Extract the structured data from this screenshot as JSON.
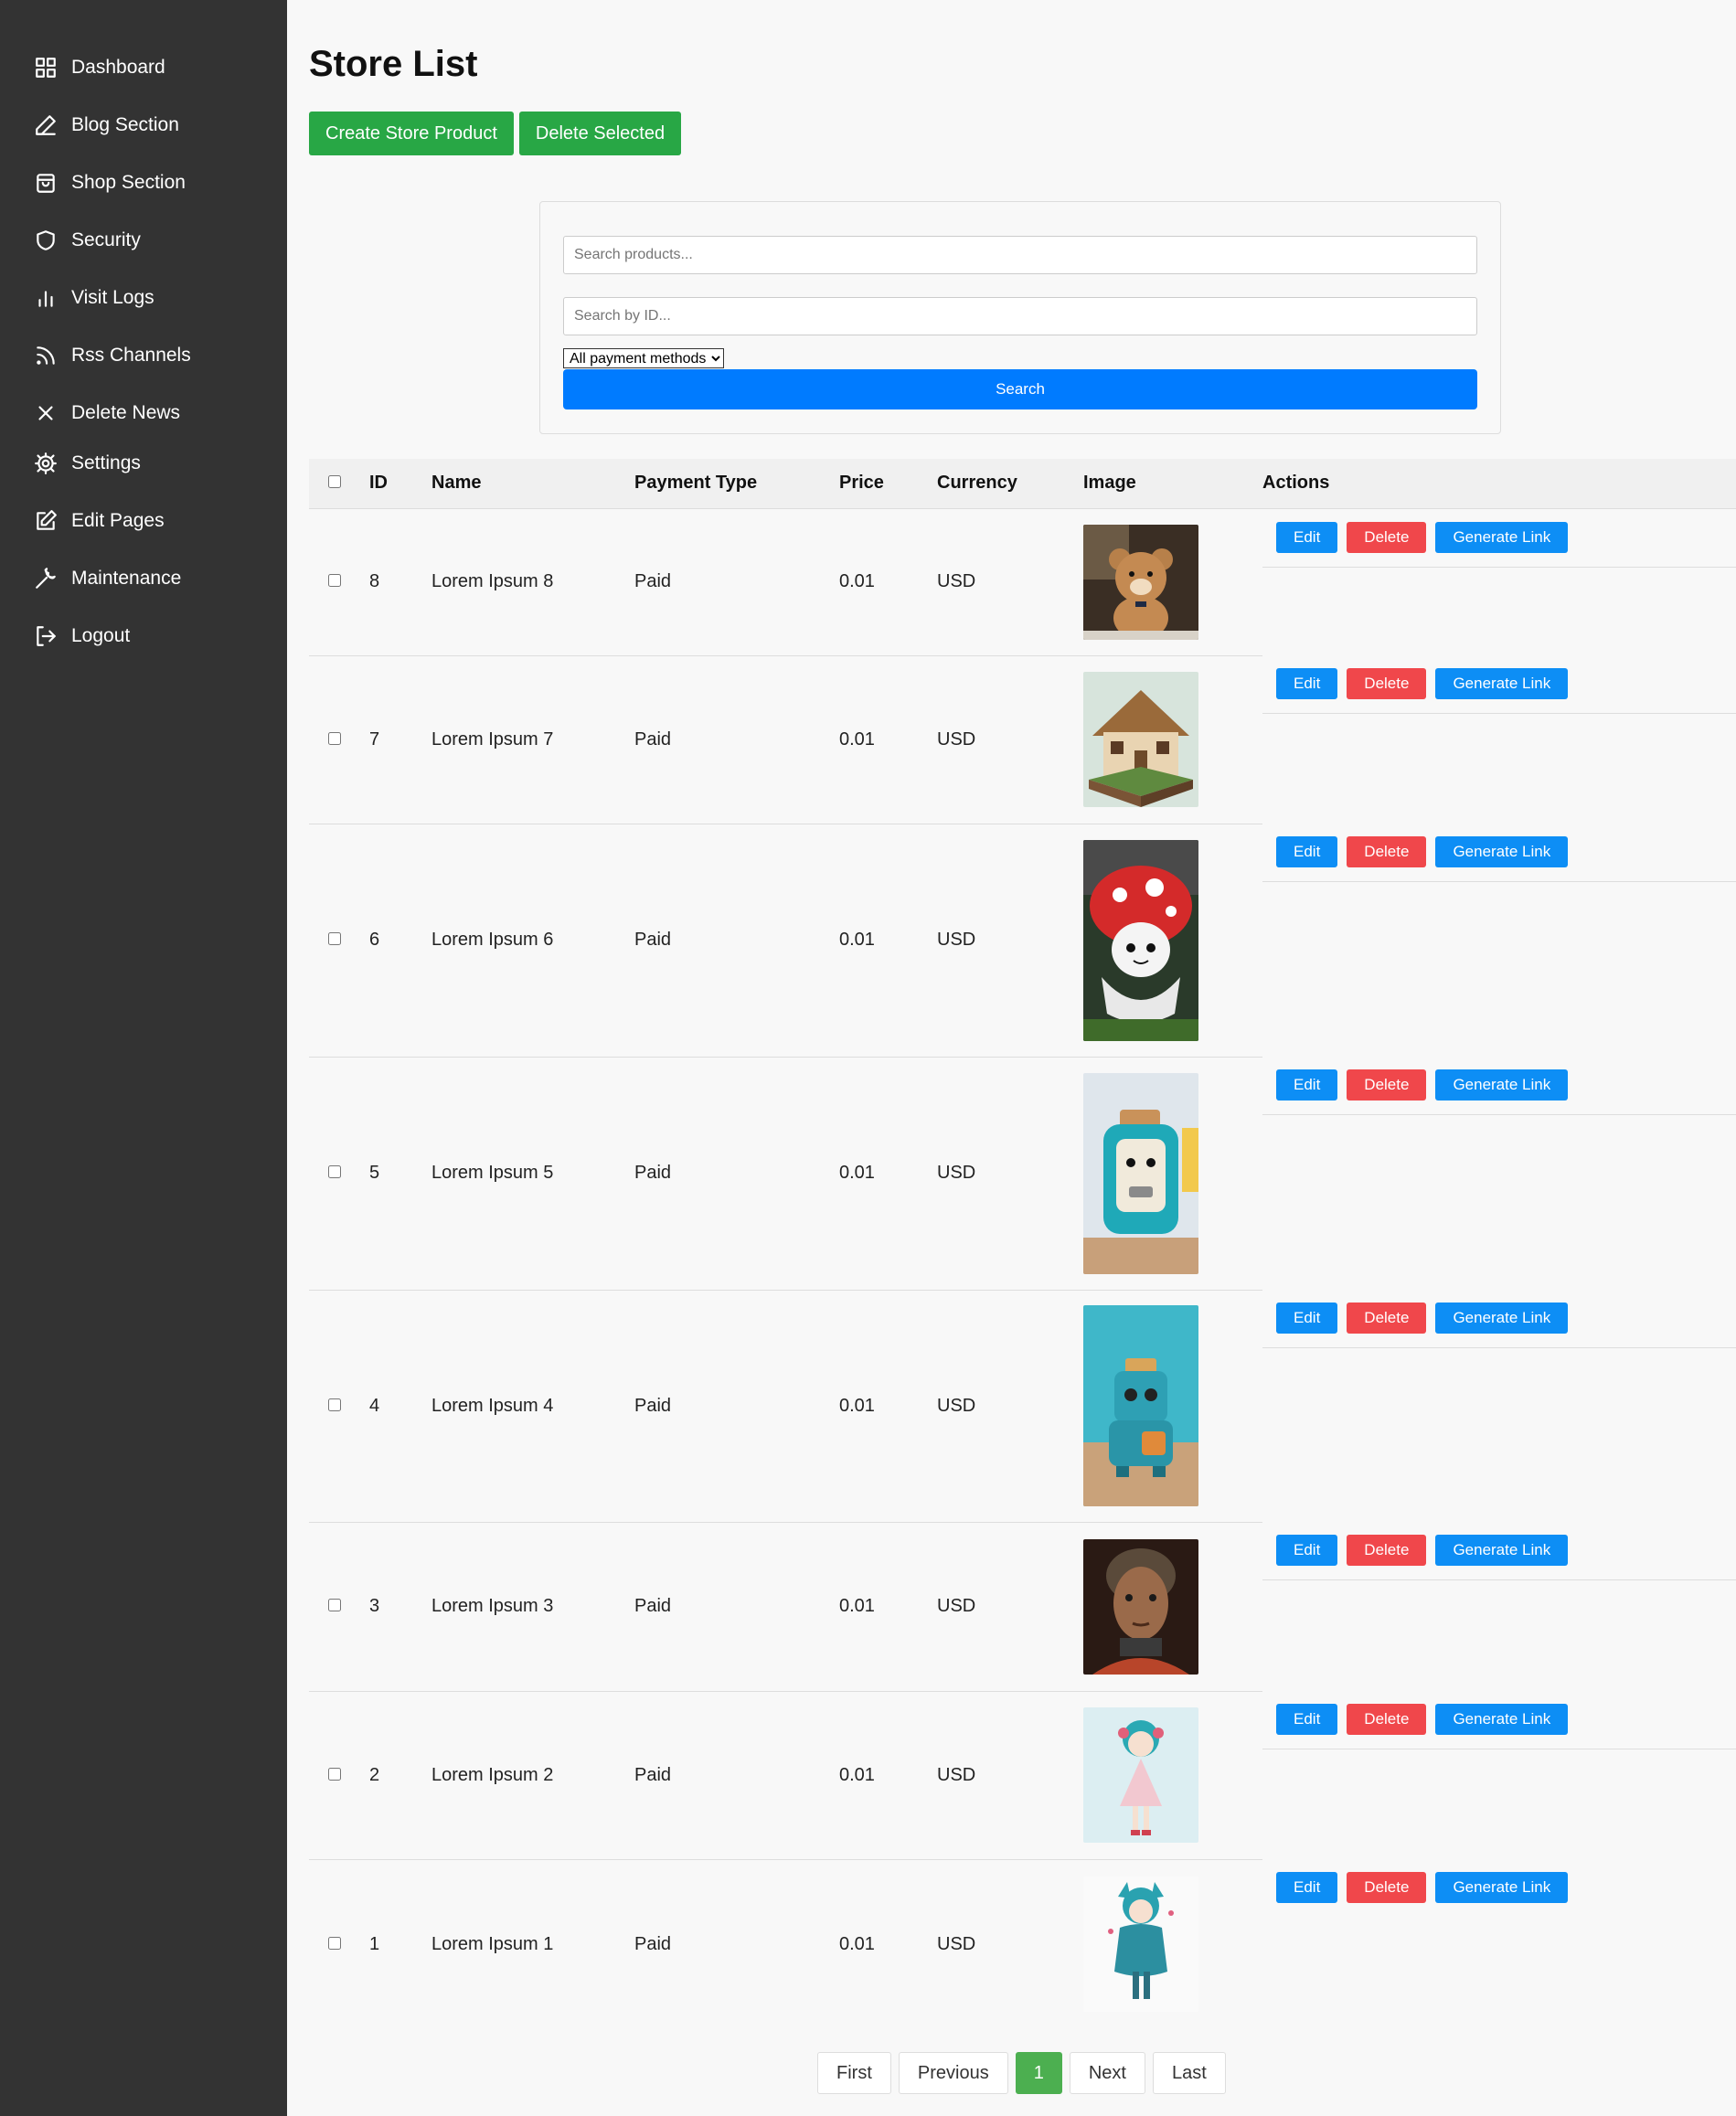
{
  "sidebar": {
    "items": [
      {
        "label": "Dashboard",
        "icon": "grid-icon"
      },
      {
        "label": "Blog Section",
        "icon": "pen-icon"
      },
      {
        "label": "Shop Section",
        "icon": "shopping-bag-icon"
      },
      {
        "label": "Security",
        "icon": "shield-icon"
      },
      {
        "label": "Visit Logs",
        "icon": "bar-chart-icon"
      },
      {
        "label": "Rss Channels",
        "icon": "rss-icon"
      },
      {
        "label": "Delete News",
        "icon": "close-icon"
      },
      {
        "label": "Settings",
        "icon": "gear-icon"
      },
      {
        "label": "Edit Pages",
        "icon": "edit-icon"
      },
      {
        "label": "Maintenance",
        "icon": "wrench-icon"
      },
      {
        "label": "Logout",
        "icon": "logout-icon"
      }
    ]
  },
  "header": {
    "title": "Store List",
    "create_label": "Create Store Product",
    "delete_selected_label": "Delete Selected"
  },
  "search": {
    "products_placeholder": "Search products...",
    "id_placeholder": "Search by ID...",
    "payment_selected": "All payment methods",
    "button_label": "Search"
  },
  "table": {
    "headers": {
      "id": "ID",
      "name": "Name",
      "payment": "Payment Type",
      "price": "Price",
      "currency": "Currency",
      "image": "Image",
      "actions": "Actions"
    },
    "action_labels": {
      "edit": "Edit",
      "delete": "Delete",
      "link": "Generate Link"
    },
    "rows": [
      {
        "id": "8",
        "name": "Lorem Ipsum 8",
        "payment": "Paid",
        "price": "0.01",
        "currency": "USD",
        "image": "teddy-bear-image"
      },
      {
        "id": "7",
        "name": "Lorem Ipsum 7",
        "payment": "Paid",
        "price": "0.01",
        "currency": "USD",
        "image": "cottage-house-image"
      },
      {
        "id": "6",
        "name": "Lorem Ipsum 6",
        "payment": "Paid",
        "price": "0.01",
        "currency": "USD",
        "image": "mushroom-character-image"
      },
      {
        "id": "5",
        "name": "Lorem Ipsum 5",
        "payment": "Paid",
        "price": "0.01",
        "currency": "USD",
        "image": "toaster-character-image"
      },
      {
        "id": "4",
        "name": "Lorem Ipsum 4",
        "payment": "Paid",
        "price": "0.01",
        "currency": "USD",
        "image": "robot-toaster-image"
      },
      {
        "id": "3",
        "name": "Lorem Ipsum 3",
        "payment": "Paid",
        "price": "0.01",
        "currency": "USD",
        "image": "cyborg-portrait-image"
      },
      {
        "id": "2",
        "name": "Lorem Ipsum 2",
        "payment": "Paid",
        "price": "0.01",
        "currency": "USD",
        "image": "anime-girl-image"
      },
      {
        "id": "1",
        "name": "Lorem Ipsum 1",
        "payment": "Paid",
        "price": "0.01",
        "currency": "USD",
        "image": "anime-figure-image"
      }
    ]
  },
  "pagination": {
    "first": "First",
    "previous": "Previous",
    "current": "1",
    "next": "Next",
    "last": "Last"
  },
  "colors": {
    "sidebar_bg": "#333333",
    "primary": "#007bff",
    "success": "#28a745",
    "danger": "#f0474b",
    "info": "#0d8ef5"
  }
}
